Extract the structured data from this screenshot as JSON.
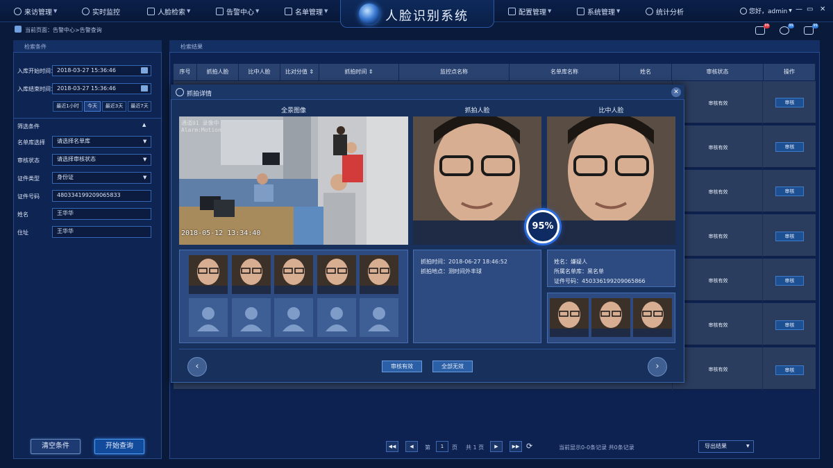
{
  "nav": {
    "left_items": [
      "来访管理",
      "实时监控",
      "人脸检索",
      "告警中心",
      "名单管理"
    ],
    "app_title": "人脸识别系统",
    "right_items": [
      "配置管理",
      "系统管理",
      "统计分析"
    ],
    "user": "您好，admin",
    "win_min": "—",
    "win_max": "▭",
    "win_close": "✕"
  },
  "header": {
    "breadcrumb": "当前页面：告警中心>告警查询",
    "badges": [
      "99",
      "99",
      "99"
    ]
  },
  "left": {
    "panel_title": "检索条件",
    "start_label": "入库开始时间：",
    "start_value": "2018-03-27   15:36:46",
    "end_label": "入库结束时间：",
    "end_value": "2018-03-27   15:36:46",
    "quick": [
      "最近1小时",
      "今天",
      "最近3天",
      "最近7天"
    ],
    "filter_title": "筛选条件",
    "fields": [
      {
        "label": "名单库选择",
        "value": "请选择名单库"
      },
      {
        "label": "审核状态",
        "value": "请选择审核状态"
      },
      {
        "label": "证件类型",
        "value": "身份证"
      },
      {
        "label": "证件号码",
        "value": "480334199209065833"
      },
      {
        "label": "姓名",
        "value": "王华华"
      },
      {
        "label": "住址",
        "value": "王华华"
      }
    ],
    "clear_btn": "清空条件",
    "search_btn": "开始查询"
  },
  "right": {
    "panel_title": "检索结果",
    "columns": [
      "序号",
      "抓拍人脸",
      "比中人脸",
      "比对分值",
      "抓拍时间",
      "监控点名称",
      "名单库名称",
      "姓名",
      "审核状态",
      "操作"
    ],
    "row_status": [
      "审核有效",
      "审核有效",
      "审核有效",
      "审核有效",
      "审核有效",
      "审核有效",
      "审核有效"
    ],
    "row_action": [
      "审核",
      "审核",
      "审核",
      "审核",
      "审核",
      "审核",
      "审核"
    ],
    "pager": {
      "first": "◀◀",
      "prev": "◀",
      "page_label_pre": "第",
      "page_num": "1",
      "page_label_post": "页",
      "total_pages": "共 1 页",
      "next": "▶",
      "last": "▶▶",
      "refresh": "⟳",
      "summary": "当前显示0-0条记录  共0条记录"
    },
    "export_label": "导出结果"
  },
  "modal": {
    "title": "抓拍详情",
    "col_full": "全景图像",
    "col_capture": "抓拍人脸",
    "col_match": "比中人脸",
    "timestamp_overlay": "2018-05-12 13:34:40",
    "camera_overlay": "通道01 录像中\nAlarm:Motion",
    "score": "95%",
    "capture_time": "抓拍时间：2018-06-27      18:46:52",
    "capture_place": "抓拍地点：测时间外丰球",
    "person_name": "姓名：嫌疑人",
    "person_list": "所属名单库：黑名单",
    "person_id": "证件号码：450336199209065866",
    "audit_valid_btn": "审核有效",
    "all_invalid_btn": "全部无效",
    "prev_arrow": "‹",
    "next_arrow": "›"
  },
  "colors": {
    "bg": "#0a1a3a",
    "panel": "#0e2452",
    "accent": "#2c6de0",
    "modal": "#17305c",
    "badge_red": "#e0343a",
    "badge_blue": "#2f7de0"
  }
}
